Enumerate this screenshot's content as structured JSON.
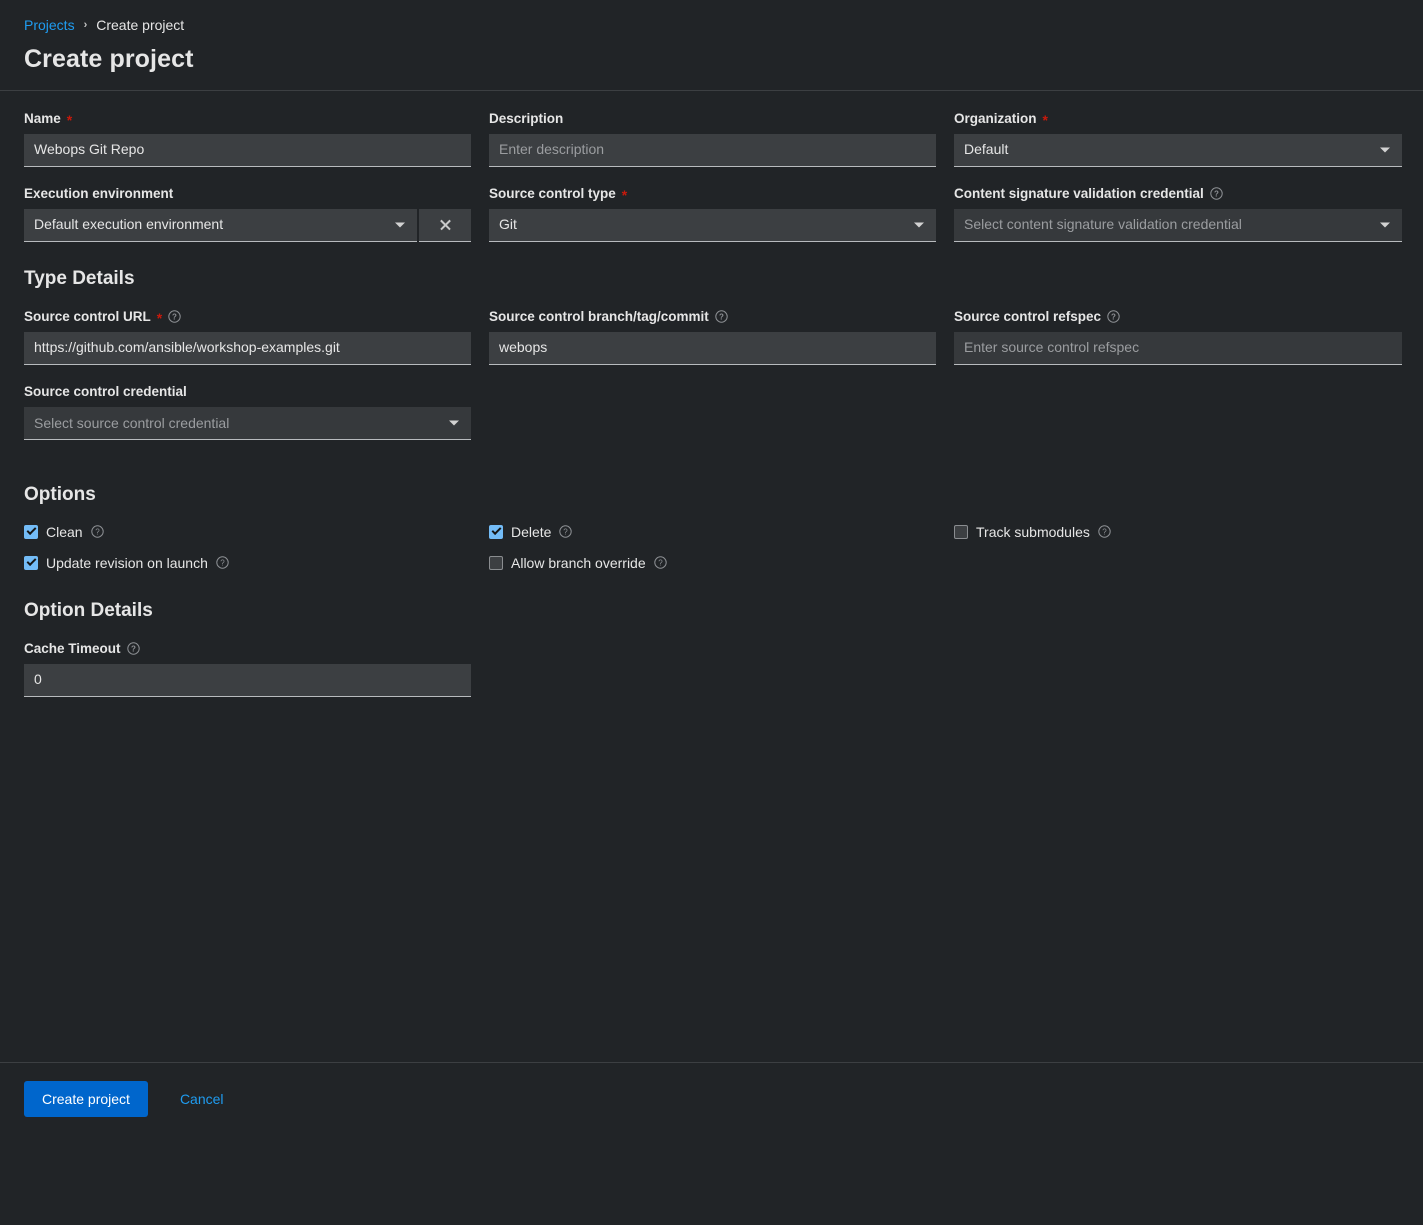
{
  "header": {
    "breadcrumb": {
      "parent": "Projects",
      "separator": "›",
      "current": "Create project"
    },
    "title": "Create project"
  },
  "form": {
    "name": {
      "label": "Name",
      "required_marker": "*",
      "value": "Webops Git Repo"
    },
    "description": {
      "label": "Description",
      "placeholder": "Enter description",
      "value": ""
    },
    "organization": {
      "label": "Organization",
      "required_marker": "*",
      "value": "Default"
    },
    "execution_environment": {
      "label": "Execution environment",
      "value": "Default execution environment",
      "clear_icon": "close-icon"
    },
    "source_control_type": {
      "label": "Source control type",
      "required_marker": "*",
      "value": "Git"
    },
    "content_signature_validation_credential": {
      "label": "Content signature validation credential",
      "help_icon": "help-icon",
      "placeholder": "Select content signature validation credential",
      "value": ""
    }
  },
  "type_details": {
    "title": "Type Details",
    "source_control_url": {
      "label": "Source control URL",
      "required_marker": "*",
      "help_icon": "help-icon",
      "value": "https://github.com/ansible/workshop-examples.git"
    },
    "source_control_branch": {
      "label": "Source control branch/tag/commit",
      "help_icon": "help-icon",
      "value": "webops"
    },
    "source_control_refspec": {
      "label": "Source control refspec",
      "help_icon": "help-icon",
      "placeholder": "Enter source control refspec",
      "value": ""
    },
    "source_control_credential": {
      "label": "Source control credential",
      "placeholder": "Select source control credential",
      "value": ""
    }
  },
  "options": {
    "title": "Options",
    "items": [
      {
        "label": "Clean",
        "checked": true,
        "help_icon": "help-icon",
        "column": 1,
        "row": 1
      },
      {
        "label": "Delete",
        "checked": true,
        "help_icon": "help-icon",
        "column": 2,
        "row": 1
      },
      {
        "label": "Track submodules",
        "checked": false,
        "help_icon": "help-icon",
        "column": 3,
        "row": 1
      },
      {
        "label": "Update revision on launch",
        "checked": true,
        "help_icon": "help-icon",
        "column": 1,
        "row": 2
      },
      {
        "label": "Allow branch override",
        "checked": false,
        "help_icon": "help-icon",
        "column": 2,
        "row": 2
      }
    ]
  },
  "option_details": {
    "title": "Option Details",
    "cache_timeout": {
      "label": "Cache Timeout",
      "help_icon": "help-icon",
      "value": "0"
    }
  },
  "footer": {
    "submit_label": "Create project",
    "cancel_label": "Cancel"
  },
  "colors": {
    "accent": "#0066cc",
    "link": "#1f9cf0",
    "required": "#c9190b",
    "checkbox": "#73bcf7",
    "panel": "#212427",
    "input": "#3c3f42"
  }
}
